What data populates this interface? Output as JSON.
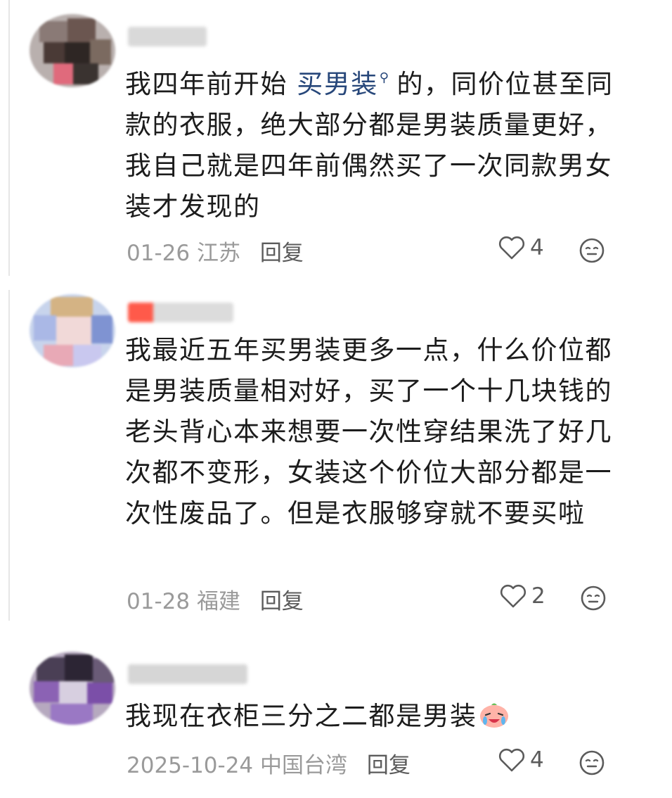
{
  "comments": [
    {
      "id": "c1",
      "text_before": "我四年前开始 ",
      "link_text": "买男装",
      "link_icon": "search-icon",
      "text_after": "的，同价位甚至同款的衣服，绝大部分都是男装质量更好，我自己就是四年前偶然买了一次同款男女装才发现的",
      "date": "01-26",
      "location": "江苏",
      "reply_label": "回复",
      "likes": "4",
      "like_icon": "heart-outline-icon",
      "reaction_icon": "emoji-face-icon"
    },
    {
      "id": "c2",
      "text": "我最近五年买男装更多一点，什么价位都是男装质量相对好，买了一个十几块钱的老头背心本来想要一次性穿结果洗了好几次都不变形，女装这个价位大部分都是一次性废品了。但是衣服够穿就不要买啦",
      "date": "01-28",
      "location": "福建",
      "reply_label": "回复",
      "likes": "2",
      "like_icon": "heart-outline-icon",
      "reaction_icon": "emoji-face-icon"
    },
    {
      "id": "c3",
      "text": "我现在衣柜三分之二都是男装",
      "trailing_emoji": "crying-laugh-emoji",
      "date": "2025-10-24",
      "location": "中国台湾",
      "reply_label": "回复",
      "likes": "4",
      "like_icon": "heart-outline-icon",
      "reaction_icon": "emoji-face-icon"
    }
  ],
  "colors": {
    "text": "#1c1c1c",
    "link": "#27477a",
    "meta": "#9a9a9a",
    "action": "#5b5b5b"
  }
}
